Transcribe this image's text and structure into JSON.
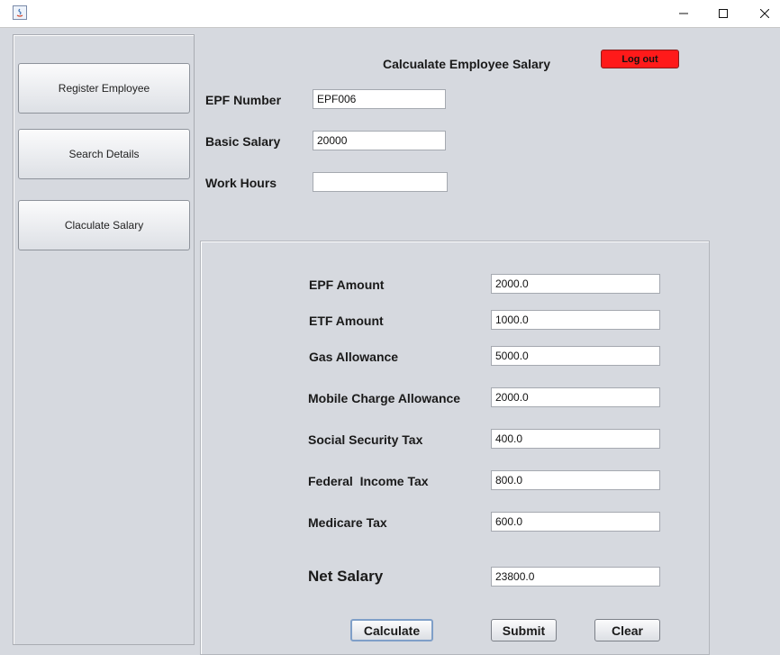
{
  "window": {
    "title": "",
    "minimize_glyph": "—",
    "maximize_glyph": "☐",
    "close_glyph": "✕"
  },
  "sidebar": {
    "items": [
      {
        "label": "Register Employee"
      },
      {
        "label": "Search Details"
      },
      {
        "label": "Claculate Salary"
      }
    ]
  },
  "header": {
    "title": "Calcualate Employee Salary",
    "logout_label": "Log out",
    "logout_color": "#ff1a1a"
  },
  "form": {
    "epf_number": {
      "label": "EPF Number",
      "value": "EPF006"
    },
    "basic_salary": {
      "label": "Basic Salary",
      "value": "20000"
    },
    "work_hours": {
      "label": "Work Hours",
      "value": ""
    }
  },
  "results": {
    "epf_amount": {
      "label": "EPF Amount",
      "value": "2000.0"
    },
    "etf_amount": {
      "label": "ETF Amount",
      "value": "1000.0"
    },
    "gas_allowance": {
      "label": "Gas Allowance",
      "value": "5000.0"
    },
    "mobile_allowance": {
      "label": "Mobile Charge Allowance",
      "value": "2000.0"
    },
    "social_security_tax": {
      "label": "Social Security Tax",
      "value": "400.0"
    },
    "federal_income_tax": {
      "label": "Federal  Income Tax",
      "value": "800.0"
    },
    "medicare_tax": {
      "label": "Medicare Tax",
      "value": "600.0"
    },
    "net_salary": {
      "label": "Net Salary",
      "value": "23800.0"
    }
  },
  "actions": {
    "calculate_label": "Calculate",
    "submit_label": "Submit",
    "clear_label": "Clear"
  }
}
